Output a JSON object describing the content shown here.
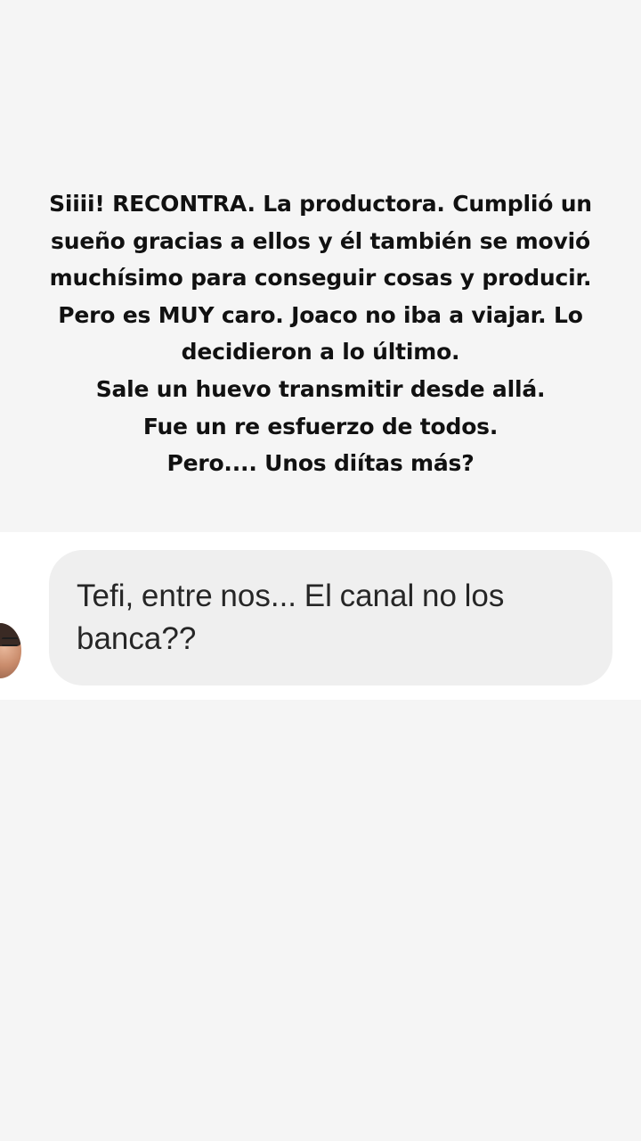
{
  "story": {
    "background_color": "#f5f5f5",
    "caption_lines": [
      "Siiii! RECONTRA. La productora. Cumplió un",
      "sueño gracias a ellos y él también se movió",
      "muchísimo para conseguir cosas y producir.",
      "Pero es MUY caro. Joaco no iba a viajar. Lo",
      "decidieron a lo último.",
      "Sale un huevo transmitir desde allá.",
      "Fue un re esfuerzo de todos.",
      "Pero.... Unos diítas más?"
    ]
  },
  "message": {
    "text": "Tefi, entre nos... El canal no los banca??",
    "bubble_color": "#efefef",
    "strip_color": "#ffffff"
  }
}
